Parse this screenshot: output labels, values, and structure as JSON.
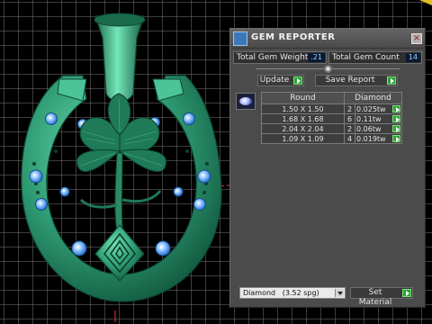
{
  "panel": {
    "title": "GEM REPORTER",
    "close_label": "×",
    "total_weight_label": "Total Gem Weight",
    "total_weight_value": ".21",
    "total_count_label": "Total Gem Count",
    "total_count_value": "14",
    "update_label": "Update",
    "save_report_label": "Save Report",
    "table": {
      "headers": [
        "Round",
        "Diamond"
      ],
      "rows": [
        {
          "size": "1.50 X 1.50",
          "count": "2",
          "ctw": "0.025tw"
        },
        {
          "size": "1.68 X 1.68",
          "count": "6",
          "ctw": "0.11tw"
        },
        {
          "size": "2.04 X 2.04",
          "count": "2",
          "ctw": "0.06tw"
        },
        {
          "size": "1.09 X 1.09",
          "count": "4",
          "ctw": "0.019tw"
        }
      ]
    },
    "material_value": "Diamond   (3.52 spg)",
    "set_material_label": "Set Material"
  },
  "colors": {
    "metal": "#2f9c74",
    "gem_blue": "#6fb3ff",
    "grid": "#6e6e6e",
    "accent_red": "#ff3030"
  },
  "icons": {
    "app": "gem-reporter-icon",
    "close": "close-icon",
    "go": "play-arrow-icon",
    "gem": "round-gem-icon"
  }
}
